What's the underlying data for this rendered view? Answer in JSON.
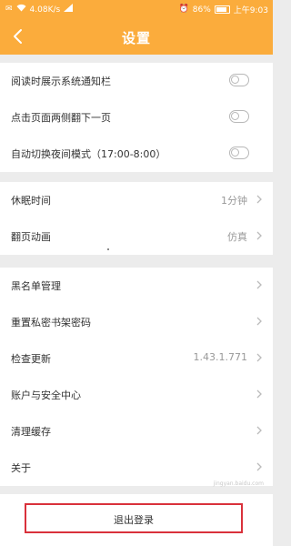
{
  "status_bar": {
    "network_speed": "4.08K/s",
    "battery_percent": "86%",
    "time": "上午9:03",
    "icons": [
      "notification-icon",
      "wifi-icon",
      "signal-icon",
      "alarm-icon",
      "battery-icon"
    ]
  },
  "header": {
    "title": "设置",
    "back_icon": "chevron-left-icon"
  },
  "groups": {
    "toggles": [
      {
        "label": "阅读时展示系统通知栏",
        "on": false
      },
      {
        "label": "点击页面两侧翻下一页",
        "on": false
      },
      {
        "label": "自动切换夜间模式（17:00-8:00）",
        "on": false
      }
    ],
    "reading": [
      {
        "label": "休眠时间",
        "value": "1分钟"
      },
      {
        "label": "翻页动画",
        "value": "仿真"
      }
    ],
    "account": [
      {
        "label": "黑名单管理",
        "value": ""
      },
      {
        "label": "重置私密书架密码",
        "value": ""
      },
      {
        "label": "检查更新",
        "value": "1.43.1.771"
      },
      {
        "label": "账户与安全中心",
        "value": ""
      },
      {
        "label": "清理缓存",
        "value": ""
      },
      {
        "label": "关于",
        "value": ""
      }
    ]
  },
  "logout": {
    "label": "退出登录"
  },
  "watermark": "jingyan.baidu.com",
  "colors": {
    "accent": "#fbac3c",
    "highlight": "#d9313b",
    "background": "#ececec"
  }
}
